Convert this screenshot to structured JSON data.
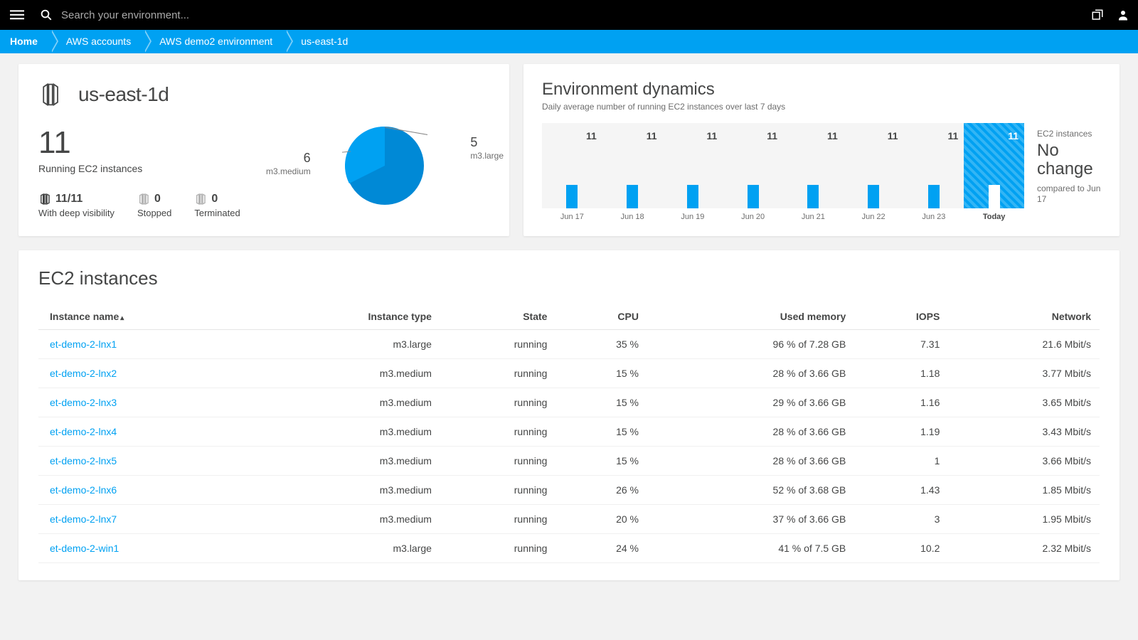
{
  "topbar": {
    "search_placeholder": "Search your environment..."
  },
  "breadcrumb": [
    "Home",
    "AWS accounts",
    "AWS demo2 environment",
    "us-east-1d"
  ],
  "region": {
    "title": "us-east-1d",
    "running_count": "11",
    "running_label": "Running EC2 instances",
    "stats": [
      {
        "value": "11/11",
        "label": "With deep visibility"
      },
      {
        "value": "0",
        "label": "Stopped"
      },
      {
        "value": "0",
        "label": "Terminated"
      }
    ]
  },
  "chart_data": [
    {
      "type": "pie",
      "title": "",
      "slices": [
        {
          "name": "m3.medium",
          "value": 6
        },
        {
          "name": "m3.large",
          "value": 5
        }
      ]
    },
    {
      "type": "bar",
      "title": "Environment dynamics",
      "subtitle": "Daily average number of running EC2 instances over last 7 days",
      "categories": [
        "Jun 17",
        "Jun 18",
        "Jun 19",
        "Jun 20",
        "Jun 21",
        "Jun 22",
        "Jun 23",
        "Today"
      ],
      "values": [
        11,
        11,
        11,
        11,
        11,
        11,
        11,
        11
      ],
      "ylim": [
        0,
        40
      ],
      "summary": {
        "label": "EC2 instances",
        "headline": "No change",
        "sub": "compared to Jun 17"
      }
    }
  ],
  "table": {
    "title": "EC2 instances",
    "columns": [
      "Instance name",
      "Instance type",
      "State",
      "CPU",
      "Used memory",
      "IOPS",
      "Network"
    ],
    "sort_indicator": "▴",
    "rows": [
      {
        "name": "et-demo-2-lnx1",
        "type": "m3.large",
        "state": "running",
        "cpu": "35 %",
        "mem": "96 % of 7.28 GB",
        "iops": "7.31",
        "net": "21.6 Mbit/s"
      },
      {
        "name": "et-demo-2-lnx2",
        "type": "m3.medium",
        "state": "running",
        "cpu": "15 %",
        "mem": "28 % of 3.66 GB",
        "iops": "1.18",
        "net": "3.77 Mbit/s"
      },
      {
        "name": "et-demo-2-lnx3",
        "type": "m3.medium",
        "state": "running",
        "cpu": "15 %",
        "mem": "29 % of 3.66 GB",
        "iops": "1.16",
        "net": "3.65 Mbit/s"
      },
      {
        "name": "et-demo-2-lnx4",
        "type": "m3.medium",
        "state": "running",
        "cpu": "15 %",
        "mem": "28 % of 3.66 GB",
        "iops": "1.19",
        "net": "3.43 Mbit/s"
      },
      {
        "name": "et-demo-2-lnx5",
        "type": "m3.medium",
        "state": "running",
        "cpu": "15 %",
        "mem": "28 % of 3.66 GB",
        "iops": "1",
        "net": "3.66 Mbit/s"
      },
      {
        "name": "et-demo-2-lnx6",
        "type": "m3.medium",
        "state": "running",
        "cpu": "26 %",
        "mem": "52 % of 3.68 GB",
        "iops": "1.43",
        "net": "1.85 Mbit/s"
      },
      {
        "name": "et-demo-2-lnx7",
        "type": "m3.medium",
        "state": "running",
        "cpu": "20 %",
        "mem": "37 % of 3.66 GB",
        "iops": "3",
        "net": "1.95 Mbit/s"
      },
      {
        "name": "et-demo-2-win1",
        "type": "m3.large",
        "state": "running",
        "cpu": "24 %",
        "mem": "41 % of 7.5 GB",
        "iops": "10.2",
        "net": "2.32 Mbit/s"
      }
    ]
  }
}
